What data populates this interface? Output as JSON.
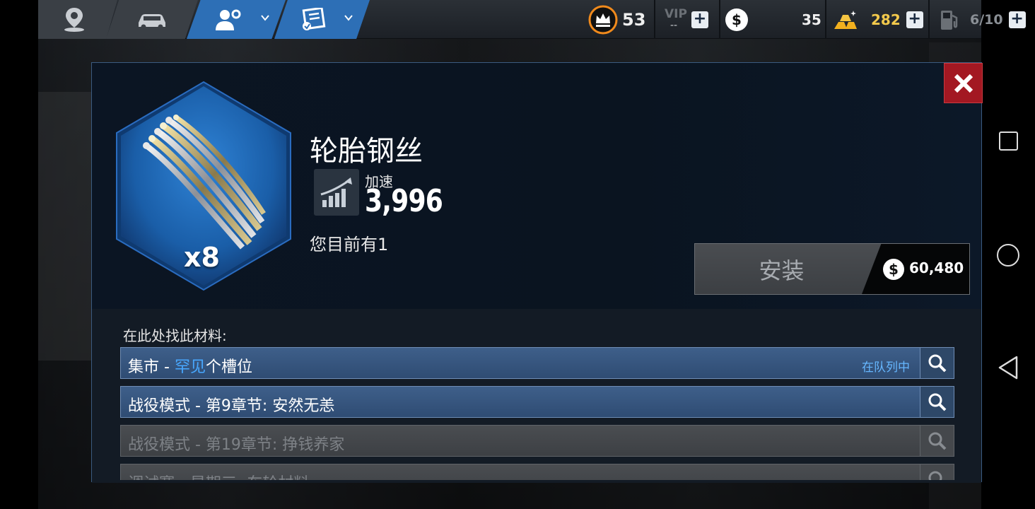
{
  "topbar": {
    "tabs": [
      {
        "name": "map",
        "icon": "map-pin-icon"
      },
      {
        "name": "garage",
        "icon": "car-icon"
      },
      {
        "name": "profile",
        "icon": "profile-settings-icon"
      },
      {
        "name": "tasks",
        "icon": "checklist-icon"
      }
    ],
    "crown_level": "53",
    "vip_label": "VIP",
    "vip_value": "--",
    "cash": "35",
    "gold": "282",
    "fuel": "6/10"
  },
  "modal": {
    "item_name": "轮胎钢丝",
    "quantity": "x8",
    "stat_label": "加速",
    "stat_value": "3,996",
    "owned_text": "您目前有1",
    "install_label": "安装",
    "install_price": "60,480",
    "find_label": "在此处找此材料:",
    "sources": [
      {
        "prefix": "集市 - ",
        "highlight": "罕见",
        "suffix": "个槽位",
        "status": "在队列中",
        "enabled": true
      },
      {
        "prefix": "战役模式 - 第9章节: 安然无恙",
        "highlight": "",
        "suffix": "",
        "status": "",
        "enabled": true
      },
      {
        "prefix": "战役模式 - 第19章节: 挣钱养家",
        "highlight": "",
        "suffix": "",
        "status": "",
        "enabled": false
      },
      {
        "prefix": "调试赛 - 星期三: 车轮材料",
        "highlight": "",
        "suffix": "",
        "status": "",
        "enabled": false
      }
    ]
  },
  "colors": {
    "accent_blue": "#2d6fb6",
    "highlight_blue": "#48a8ff",
    "close_red": "#a31822",
    "gold_text": "#f2c94c"
  }
}
